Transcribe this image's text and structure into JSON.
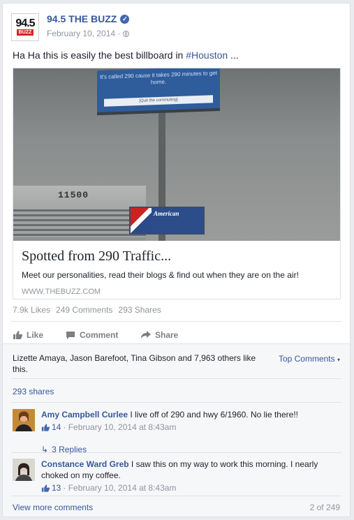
{
  "page": {
    "name": "94.5 THE BUZZ",
    "logo_number": "94.5",
    "logo_text": "BUZZ",
    "date": "February 10, 2014 ·",
    "post_text_pre": "Ha Ha this is easily the best billboard in ",
    "hashtag": "#Houston",
    "post_text_post": " ..."
  },
  "link": {
    "title": "Spotted from 290 Traffic...",
    "description": "Meet our personalities, read their blogs & find out when they are on the air!",
    "domain": "WWW.THEBUZZ.COM",
    "billboard_text": "It's called 290 cause it takes 290 minutes to get home.",
    "billboard_strip": "[Quit the commuting]",
    "building_number": "11500",
    "sign_text": "American"
  },
  "stats": {
    "likes": "7.9k Likes",
    "comments": "249 Comments",
    "shares": "293 Shares"
  },
  "actions": {
    "like": "Like",
    "comment": "Comment",
    "share": "Share"
  },
  "comments_section": {
    "likes_summary": "Lizette Amaya, Jason Barefoot, Tina Gibson and 7,963 others like this.",
    "top_comments": "Top Comments",
    "shares": "293 shares",
    "comments": [
      {
        "author": "Amy Campbell Curlee",
        "text": "I live off of 290 and hwy 6/1960. No lie there!!",
        "likes": "14",
        "date": "· February 10, 2014 at 8:43am",
        "replies": "3 Replies"
      },
      {
        "author": "Constance Ward Greb",
        "text": "I saw this on my way to work this morning. I nearly choked on my coffee.",
        "likes": "13",
        "date": "· February 10, 2014 at 8:43am"
      }
    ],
    "view_more": "View more comments",
    "pager": "2 of 249"
  },
  "colors": {
    "link": "#365899",
    "meta": "#90949c",
    "text": "#1d2129"
  }
}
